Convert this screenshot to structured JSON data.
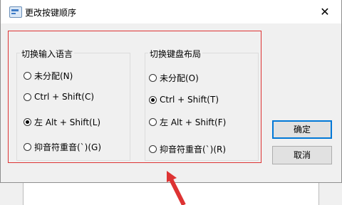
{
  "window": {
    "title": "更改按键顺序",
    "close_glyph": "✕"
  },
  "left_group": {
    "label": "切换输入语言",
    "options": [
      {
        "label": "未分配(N)",
        "checked": false
      },
      {
        "label": "Ctrl + Shift(C)",
        "checked": false
      },
      {
        "label": "左 Alt + Shift(L)",
        "checked": true
      },
      {
        "label": "抑音符重音(`)(G)",
        "checked": false
      }
    ]
  },
  "right_group": {
    "label": "切换键盘布局",
    "options": [
      {
        "label": "未分配(O)",
        "checked": false
      },
      {
        "label": "Ctrl + Shift(T)",
        "checked": true
      },
      {
        "label": "左 Alt + Shift(F)",
        "checked": false
      },
      {
        "label": "抑音符重音(`)(R)",
        "checked": false
      }
    ]
  },
  "buttons": {
    "ok": "确定",
    "cancel": "取消"
  },
  "colors": {
    "highlight": "#dd3333",
    "accent": "#0078d7"
  }
}
